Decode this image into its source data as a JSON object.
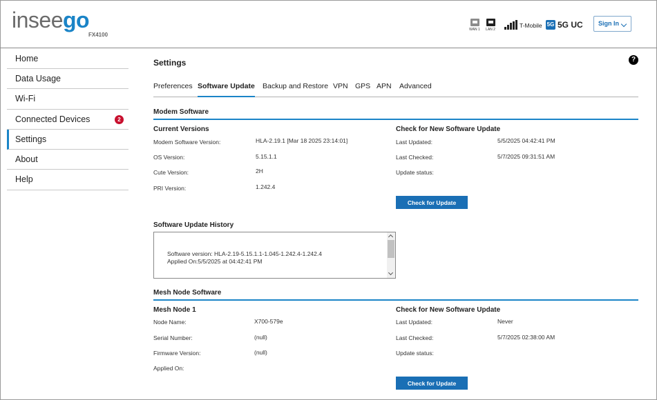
{
  "header": {
    "brand_part1": "insee",
    "brand_part2": "go",
    "model": "FX4100",
    "wan_label": "WAN 1",
    "lan_label": "LAN 2",
    "carrier": "T-Mobile",
    "network_type": "5G UC",
    "network_badge": "5G",
    "signin_label": "Sign In"
  },
  "sidebar": {
    "items": [
      {
        "label": "Home"
      },
      {
        "label": "Data Usage"
      },
      {
        "label": "Wi-Fi"
      },
      {
        "label": "Connected Devices",
        "badge": "2"
      },
      {
        "label": "Settings",
        "active": true
      },
      {
        "label": "About"
      },
      {
        "label": "Help"
      }
    ]
  },
  "main": {
    "title": "Settings",
    "help": "?",
    "tabs": [
      {
        "label": "Preferences"
      },
      {
        "label": "Software Update",
        "active": true
      },
      {
        "label": "Backup and Restore"
      },
      {
        "label": "VPN"
      },
      {
        "label": "GPS"
      },
      {
        "label": "APN"
      },
      {
        "label": "Advanced"
      }
    ]
  },
  "modem": {
    "section_title": "Modem Software",
    "current_versions": "Current Versions",
    "rows": [
      {
        "label": "Modem Software Version:",
        "value": "HLA-2.19.1 [Mar 18 2025 23:14:01]"
      },
      {
        "label": "OS Version:",
        "value": "5.15.1.1"
      },
      {
        "label": "Cute Version:",
        "value": "2H"
      },
      {
        "label": "PRI Version:",
        "value": "1.242.4"
      }
    ],
    "check_title": "Check for New Software Update",
    "check_rows": [
      {
        "label": "Last Updated:",
        "value": "5/5/2025 04:42:41 PM"
      },
      {
        "label": "Last Checked:",
        "value": "5/7/2025 09:31:51 AM"
      },
      {
        "label": "Update status:",
        "value": ""
      }
    ],
    "button": "Check for Update"
  },
  "history": {
    "title": "Software Update History",
    "line1": "Software version: HLA-2.19-5.15.1.1-1.045-1.242.4-1.242.4",
    "line2": "Applied On:5/5/2025 at 04:42:41 PM"
  },
  "mesh": {
    "section_title": "Mesh Node Software",
    "node_title": "Mesh Node 1",
    "rows": [
      {
        "label": "Node Name:",
        "value": "X700-579e"
      },
      {
        "label": "Serial Number:",
        "value": "(null)"
      },
      {
        "label": "Firmware Version:",
        "value": "(null)"
      },
      {
        "label": "Applied On:",
        "value": ""
      }
    ],
    "check_title": "Check for New Software Update",
    "check_rows": [
      {
        "label": "Last Updated:",
        "value": "Never"
      },
      {
        "label": "Last Checked:",
        "value": "5/7/2025 02:38:00 AM"
      },
      {
        "label": "Update status:",
        "value": ""
      }
    ],
    "button": "Check for Update"
  },
  "colors": {
    "accent": "#1a84c7",
    "button": "#1a6fb5",
    "badge": "#c8102e"
  }
}
